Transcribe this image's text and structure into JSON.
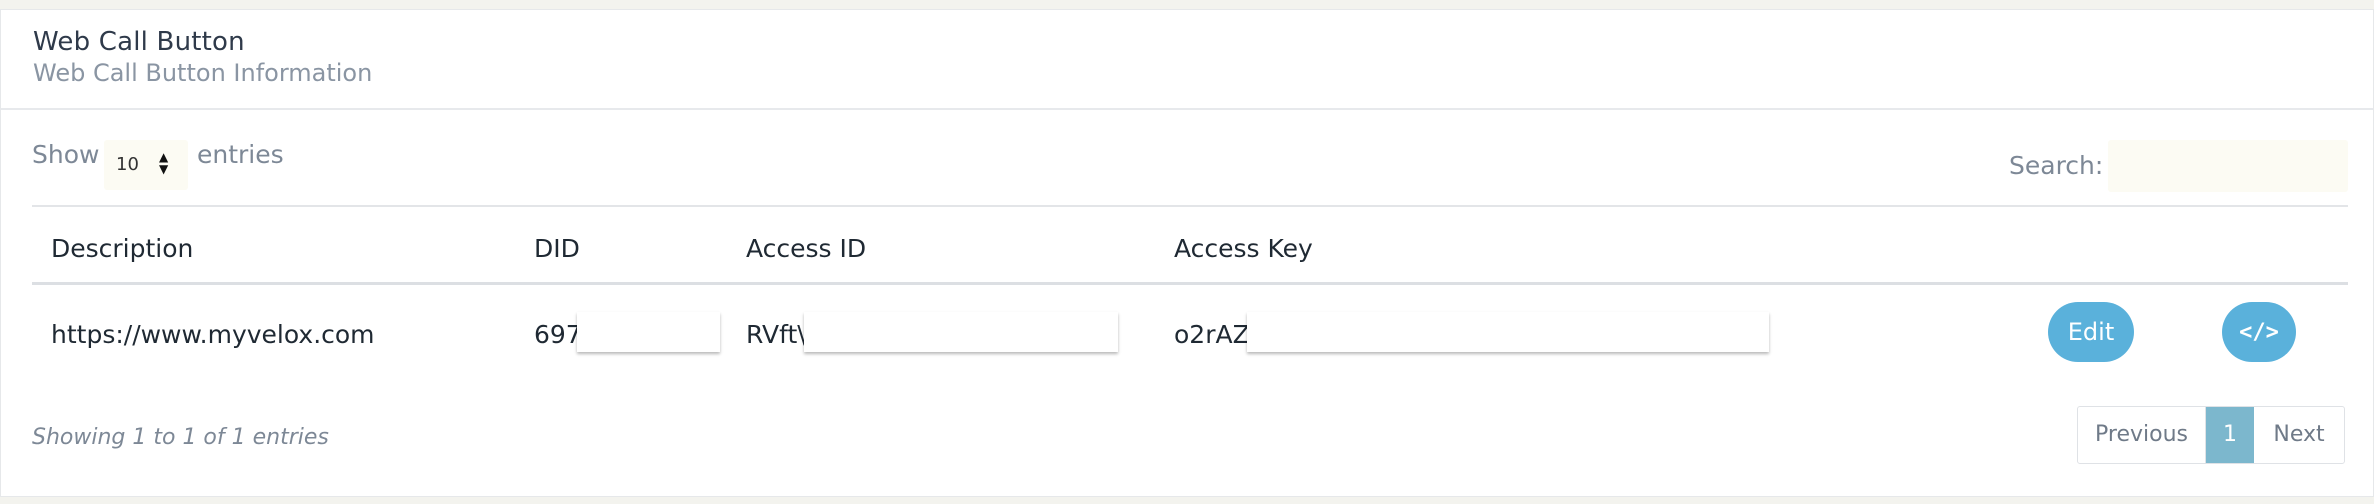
{
  "header": {
    "title": "Web Call Button",
    "subtitle": "Web Call Button Information"
  },
  "controls": {
    "show_label": "Show",
    "page_length": "10",
    "entries_label": "entries",
    "search_label": "Search:",
    "search_value": ""
  },
  "table": {
    "columns": [
      "Description",
      "DID",
      "Access ID",
      "Access Key"
    ],
    "rows": [
      {
        "description": "https://www.myvelox.com",
        "did": "697",
        "access_id": "RVft\\",
        "access_key": "o2rAZ",
        "edit_label": "Edit",
        "code_label": "</>"
      }
    ]
  },
  "footer": {
    "info": "Showing 1 to 1 of 1 entries",
    "previous_label": "Previous",
    "current_page": "1",
    "next_label": "Next"
  },
  "colors": {
    "accent": "#5ab1db",
    "active_page": "#7cb7cd"
  }
}
